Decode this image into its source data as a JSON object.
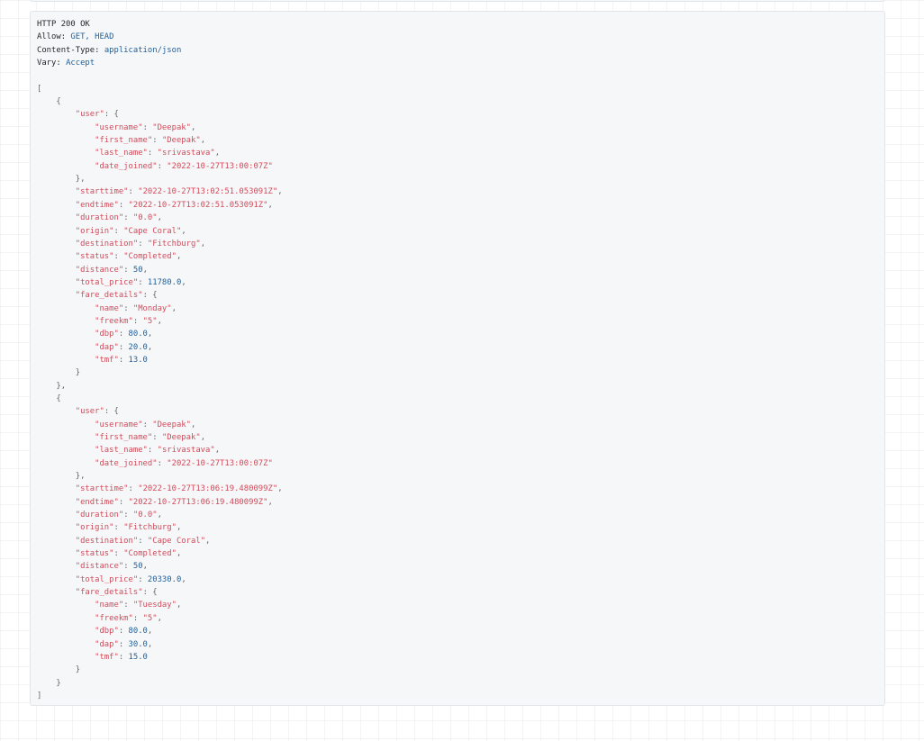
{
  "response": {
    "status_line": "HTTP 200 OK",
    "headers": [
      {
        "name": "Allow",
        "value": "GET, HEAD"
      },
      {
        "name": "Content-Type",
        "value": "application/json"
      },
      {
        "name": "Vary",
        "value": "Accept"
      }
    ],
    "records": [
      {
        "user": {
          "username": "Deepak",
          "first_name": "Deepak",
          "last_name": "srivastava",
          "date_joined": "2022-10-27T13:00:07Z"
        },
        "starttime": "2022-10-27T13:02:51.053091Z",
        "endtime": "2022-10-27T13:02:51.053091Z",
        "duration": "0.0",
        "origin": "Cape Coral",
        "destination": "Fitchburg",
        "status": "Completed",
        "distance": "50",
        "total_price": "11780.0",
        "fare_details": {
          "name": "Monday",
          "freekm": "5",
          "dbp": "80.0",
          "dap": "20.0",
          "tmf": "13.0"
        }
      },
      {
        "user": {
          "username": "Deepak",
          "first_name": "Deepak",
          "last_name": "srivastava",
          "date_joined": "2022-10-27T13:00:07Z"
        },
        "starttime": "2022-10-27T13:06:19.480099Z",
        "endtime": "2022-10-27T13:06:19.480099Z",
        "duration": "0.0",
        "origin": "Fitchburg",
        "destination": "Cape Coral",
        "status": "Completed",
        "distance": "50",
        "total_price": "20330.0",
        "fare_details": {
          "name": "Tuesday",
          "freekm": "5",
          "dbp": "80.0",
          "dap": "30.0",
          "tmf": "15.0"
        }
      }
    ]
  }
}
